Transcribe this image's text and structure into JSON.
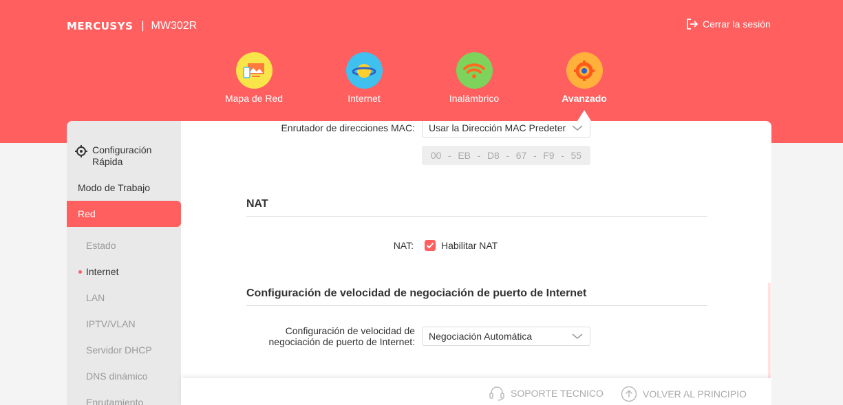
{
  "header": {
    "brand": "MERCUSYS",
    "separator": "|",
    "model": "MW302R",
    "logout_label": "Cerrar la sesión"
  },
  "nav": {
    "items": [
      {
        "label": "Mapa de Red",
        "icon": "network-map-icon",
        "color": "#f9e44a"
      },
      {
        "label": "Internet",
        "icon": "planet-icon",
        "color": "#3fc0ef"
      },
      {
        "label": "Inalámbrico",
        "icon": "wifi-icon",
        "color": "#7dd35c"
      },
      {
        "label": "Avanzado",
        "icon": "gear-icon",
        "color": "#ffb13b",
        "active": true
      }
    ]
  },
  "sidebar": {
    "quick_setup": "Configuración Rápida",
    "items": [
      {
        "label": "Modo de Trabajo"
      },
      {
        "label": "Red",
        "active": true
      }
    ],
    "subitems": [
      {
        "label": "Estado"
      },
      {
        "label": "Internet",
        "current": true
      },
      {
        "label": "LAN"
      },
      {
        "label": "IPTV/VLAN"
      },
      {
        "label": "Servidor DHCP"
      },
      {
        "label": "DNS dinámico"
      },
      {
        "label": "Enrutamiento"
      }
    ]
  },
  "content": {
    "mac_router_label": "Enrutador de direcciones MAC:",
    "mac_router_value": "Usar la Dirección MAC Predeterminada",
    "mac_octets": [
      "00",
      "EB",
      "D8",
      "67",
      "F9",
      "55"
    ],
    "mac_separator": "-",
    "nat_title": "NAT",
    "nat_label": "NAT:",
    "nat_checkbox_label": "Habilitar NAT",
    "nat_enabled": true,
    "speed_title": "Configuración de velocidad de negociación de puerto de Internet",
    "speed_label_line1": "Configuración de velocidad de",
    "speed_label_line2": "negociación de puerto de Internet:",
    "speed_value": "Negociación Automática"
  },
  "footer": {
    "support": "SOPORTE TECNICO",
    "back_to_top": "VOLVER AL PRINCIPIO"
  },
  "colors": {
    "accent": "#ff5f5f",
    "sidebar_bg": "#e9e9e9"
  }
}
